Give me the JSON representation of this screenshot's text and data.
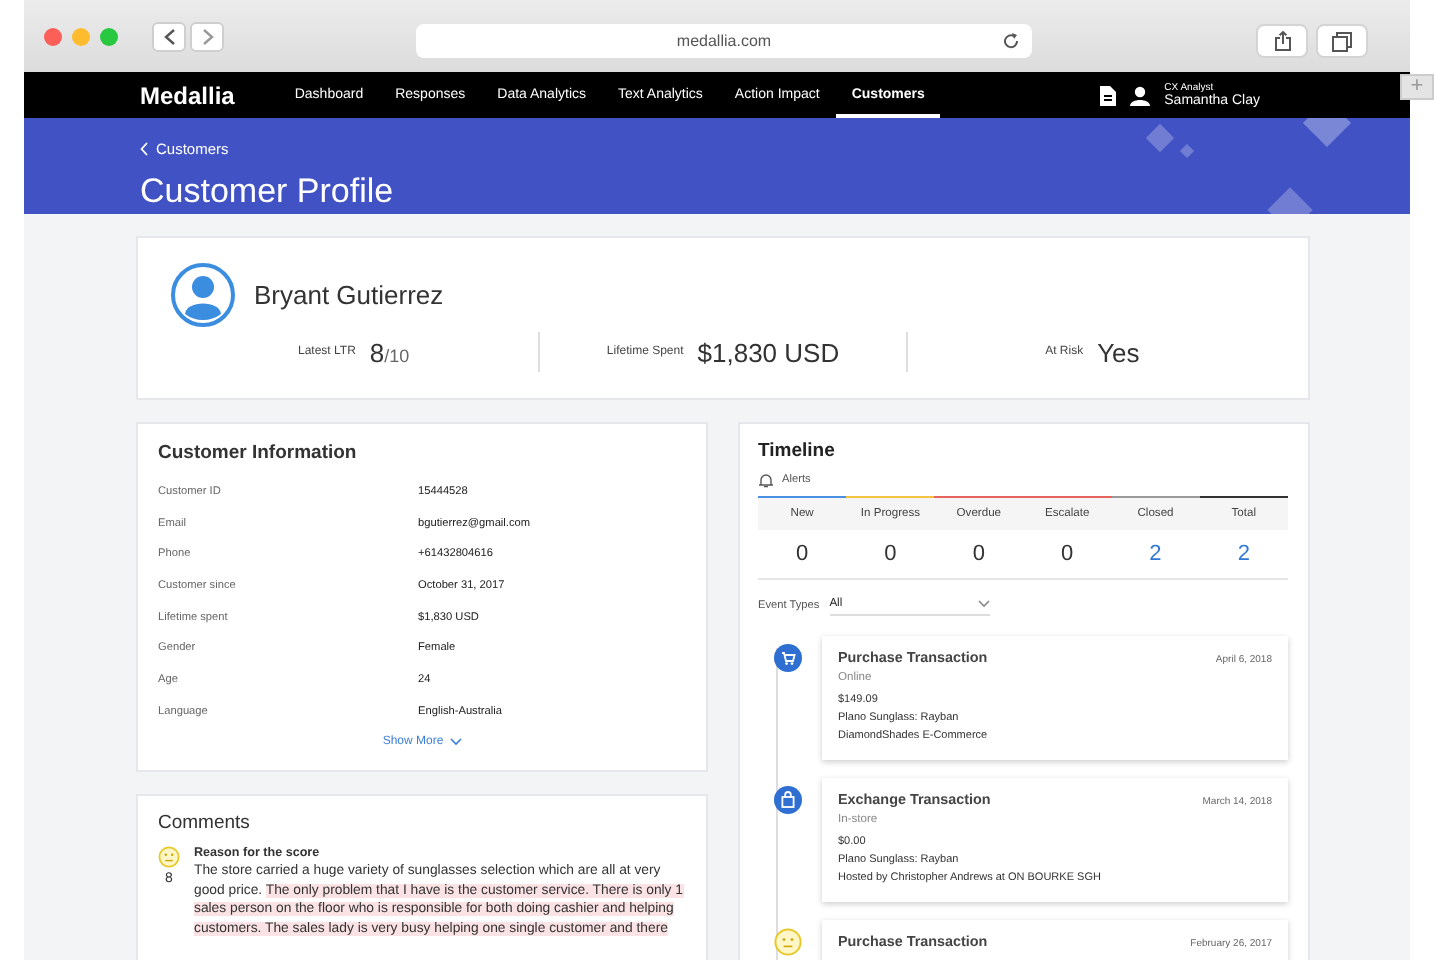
{
  "browser": {
    "url": "medallia.com",
    "new_tab": "+"
  },
  "nav": {
    "logo": "Medallia",
    "items": [
      {
        "label": "Dashboard",
        "selected": false
      },
      {
        "label": "Responses",
        "selected": false
      },
      {
        "label": "Data Analytics",
        "selected": false
      },
      {
        "label": "Text Analytics",
        "selected": false
      },
      {
        "label": "Action Impact",
        "selected": false
      },
      {
        "label": "Customers",
        "selected": true
      }
    ],
    "user_role": "CX Analyst",
    "user_name": "Samantha Clay"
  },
  "header": {
    "breadcrumb": "Customers",
    "title": "Customer Profile"
  },
  "profile": {
    "name": "Bryant Gutierrez",
    "stats": [
      {
        "label": "Latest LTR",
        "value": "8",
        "out_of": "/10"
      },
      {
        "label": "Lifetime Spent",
        "value": "$1,830 USD"
      },
      {
        "label": "At Risk",
        "value": "Yes"
      }
    ]
  },
  "customer_information": {
    "title": "Customer Information",
    "fields": [
      {
        "label": "Customer ID",
        "value": "15444528"
      },
      {
        "label": "Email",
        "value": "bgutierrez@gmail.com"
      },
      {
        "label": "Phone",
        "value": "+61432804616"
      },
      {
        "label": "Customer since",
        "value": "October 31, 2017"
      },
      {
        "label": "Lifetime spent",
        "value": "$1,830 USD"
      },
      {
        "label": "Gender",
        "value": "Female"
      },
      {
        "label": "Age",
        "value": "24"
      },
      {
        "label": "Language",
        "value": "English-Australia"
      }
    ],
    "show_more": "Show More"
  },
  "comments": {
    "title": "Comments",
    "items": [
      {
        "score": "8",
        "heading": "Reason for the score",
        "segments": [
          {
            "text": "The store carried a huge variety of sunglasses selection which are all at very good price. ",
            "highlighted": false
          },
          {
            "text": "The only problem that I have is the customer service. There is only 1 sales person on the floor who is responsible for both doing cashier and helping customers. The sales lady is very busy helping one single customer and there",
            "highlighted": true
          }
        ]
      }
    ]
  },
  "timeline": {
    "title": "Timeline",
    "alerts_label": "Alerts",
    "alert_stats": [
      {
        "label": "New",
        "value": "0",
        "color": "#4a90e2",
        "link": false
      },
      {
        "label": "In Progress",
        "value": "0",
        "color": "#f5c242",
        "link": false
      },
      {
        "label": "Overdue",
        "value": "0",
        "color": "#e8655f",
        "link": false
      },
      {
        "label": "Escalate",
        "value": "0",
        "color": "#e8655f",
        "link": false
      },
      {
        "label": "Closed",
        "value": "2",
        "color": "#9a9a9a",
        "link": true
      },
      {
        "label": "Total",
        "value": "2",
        "color": "#333333",
        "link": true
      }
    ],
    "event_types": {
      "label": "Event Types",
      "value": "All"
    },
    "events": [
      {
        "kind": "purchase",
        "title": "Purchase Transaction",
        "date": "April 6, 2018",
        "channel": "Online",
        "lines": [
          "$149.09",
          "Plano Sunglass: Rayban",
          "DiamondShades E-Commerce"
        ]
      },
      {
        "kind": "exchange",
        "title": "Exchange Transaction",
        "date": "March 14, 2018",
        "channel": "In-store",
        "lines": [
          "$0.00",
          "Plano Sunglass: Rayban",
          "Hosted by Christopher Andrews at ON BOURKE SGH"
        ]
      },
      {
        "kind": "rating",
        "title": "Purchase Transaction",
        "date": "February 26, 2017"
      }
    ]
  }
}
